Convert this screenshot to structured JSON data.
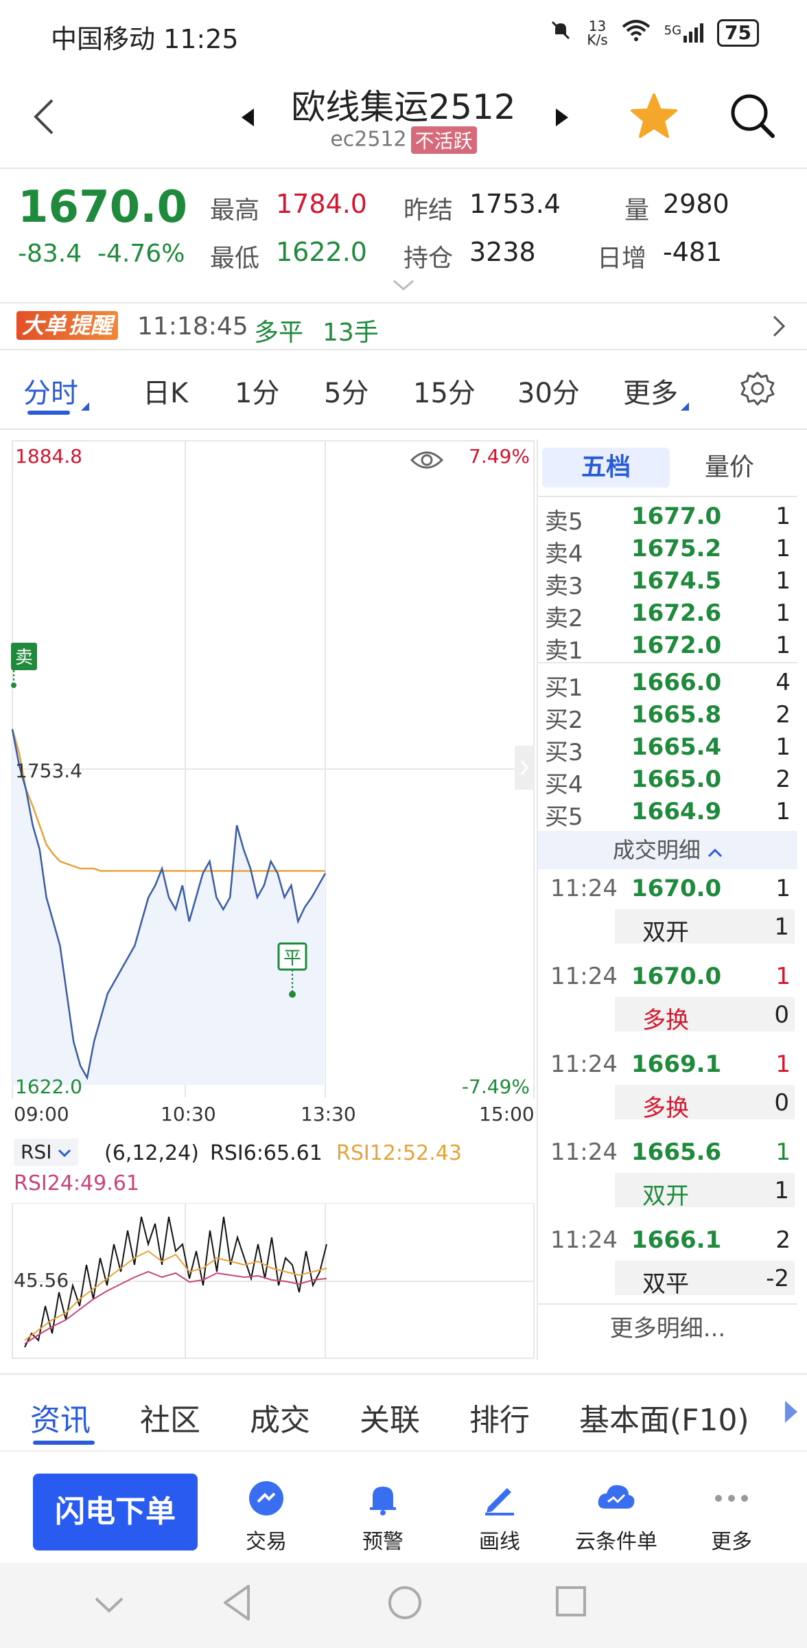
{
  "status": {
    "carrier_time": "中国移动 11:25",
    "net_speed_top": "13",
    "net_speed_bottom": "K/s",
    "signal_label": "5G",
    "battery": "75"
  },
  "header": {
    "title": "欧线集运2512",
    "code": "ec2512",
    "badge": "不活跃"
  },
  "quote": {
    "last": "1670.0",
    "change": "-83.4",
    "change_pct": "-4.76%",
    "high_label": "最高",
    "high": "1784.0",
    "low_label": "最低",
    "low": "1622.0",
    "prev_settle_label": "昨结",
    "prev_settle": "1753.4",
    "open_int_label": "持仓",
    "open_int": "3238",
    "volume_label": "量",
    "volume": "2980",
    "daily_inc_label": "日增",
    "daily_inc": "-481"
  },
  "alert": {
    "badge_a": "大单",
    "badge_b": "提醒",
    "time": "11:18:45",
    "action": "多平",
    "size": "13手"
  },
  "period_tabs": [
    "分时",
    "日K",
    "1分",
    "5分",
    "15分",
    "30分",
    "更多"
  ],
  "chart_labels": {
    "top_price": "1884.8",
    "top_pct": "7.49%",
    "mid_price": "1753.4",
    "bottom_price": "1622.0",
    "bottom_pct": "-7.49%",
    "t0": "09:00",
    "t1": "10:30",
    "t2": "13:30",
    "t3": "15:00",
    "sell_marker": "卖",
    "close_marker": "平",
    "rsi_selector": "RSI",
    "rsi_params": "(6,12,24)",
    "rsi6": "RSI6:65.61",
    "rsi12": "RSI12:52.43",
    "rsi24": "RSI24:49.61",
    "rsi_level": "45.56"
  },
  "book": {
    "tab_depth": "五档",
    "tab_volprice": "量价",
    "asks": [
      {
        "label": "卖5",
        "price": "1677.0",
        "qty": "1"
      },
      {
        "label": "卖4",
        "price": "1675.2",
        "qty": "1"
      },
      {
        "label": "卖3",
        "price": "1674.5",
        "qty": "1"
      },
      {
        "label": "卖2",
        "price": "1672.6",
        "qty": "1"
      },
      {
        "label": "卖1",
        "price": "1672.0",
        "qty": "1"
      }
    ],
    "bids": [
      {
        "label": "买1",
        "price": "1666.0",
        "qty": "4"
      },
      {
        "label": "买2",
        "price": "1665.8",
        "qty": "2"
      },
      {
        "label": "买3",
        "price": "1665.4",
        "qty": "1"
      },
      {
        "label": "买4",
        "price": "1665.0",
        "qty": "2"
      },
      {
        "label": "买5",
        "price": "1664.9",
        "qty": "1"
      }
    ],
    "trades_header": "成交明细",
    "trades": [
      {
        "time": "11:24",
        "price": "1670.0",
        "qty": "1",
        "type": "双开",
        "type_qty": "1"
      },
      {
        "time": "11:24",
        "price": "1670.0",
        "qty": "1",
        "type": "多换",
        "type_qty": "0"
      },
      {
        "time": "11:24",
        "price": "1669.1",
        "qty": "1",
        "type": "多换",
        "type_qty": "0"
      },
      {
        "time": "11:24",
        "price": "1665.6",
        "qty": "1",
        "type": "双开",
        "type_qty": "1"
      },
      {
        "time": "11:24",
        "price": "1666.1",
        "qty": "2",
        "type": "双平",
        "type_qty": "-2"
      }
    ],
    "more_trades": "更多明细..."
  },
  "info_tabs": [
    "资讯",
    "社区",
    "成交",
    "关联",
    "排行",
    "基本面(F10)"
  ],
  "toolbar": {
    "flash_order": "闪电下单",
    "trade": "交易",
    "alert": "预警",
    "draw": "画线",
    "cloud": "云条件单",
    "more": "更多"
  },
  "colors": {
    "accent": "#2a5bd7",
    "down": "#1f8a3b",
    "up": "#d2172f",
    "avg_line": "#e8a23a",
    "price_line": "#3a5ba8"
  },
  "chart_data": {
    "type": "line",
    "title": "",
    "xlabel": "",
    "ylabel": "",
    "x_ticks": [
      "09:00",
      "10:30",
      "13:30",
      "15:00"
    ],
    "ylim": [
      1622.0,
      1884.8
    ],
    "reference": 1753.4,
    "series": [
      {
        "values": [
          1770,
          1755,
          1745,
          1730,
          1720,
          1700,
          1690,
          1680,
          1660,
          1640,
          1630,
          1625,
          1640,
          1650,
          1660,
          1665,
          1670,
          1675,
          1680,
          1690,
          1700,
          1705,
          1712,
          1700,
          1695,
          1705,
          1690,
          1700,
          1710,
          1715,
          1700,
          1695,
          1700,
          1730,
          1720,
          1712,
          1700,
          1705,
          1715,
          1710,
          1700,
          1705,
          1690,
          1696,
          1700,
          1705,
          1710
        ]
      },
      {
        "values": [
          1770,
          1760,
          1745,
          1738,
          1730,
          1722,
          1718,
          1715,
          1714,
          1713,
          1712,
          1712,
          1712,
          1711,
          1711,
          1711,
          1711,
          1711,
          1711,
          1711,
          1711,
          1711,
          1711,
          1711,
          1711,
          1711,
          1711,
          1711,
          1711,
          1711,
          1711,
          1711,
          1711,
          1711,
          1711,
          1711,
          1711,
          1711,
          1711,
          1711,
          1711,
          1711,
          1711,
          1711,
          1711,
          1711,
          1711
        ]
      }
    ]
  }
}
